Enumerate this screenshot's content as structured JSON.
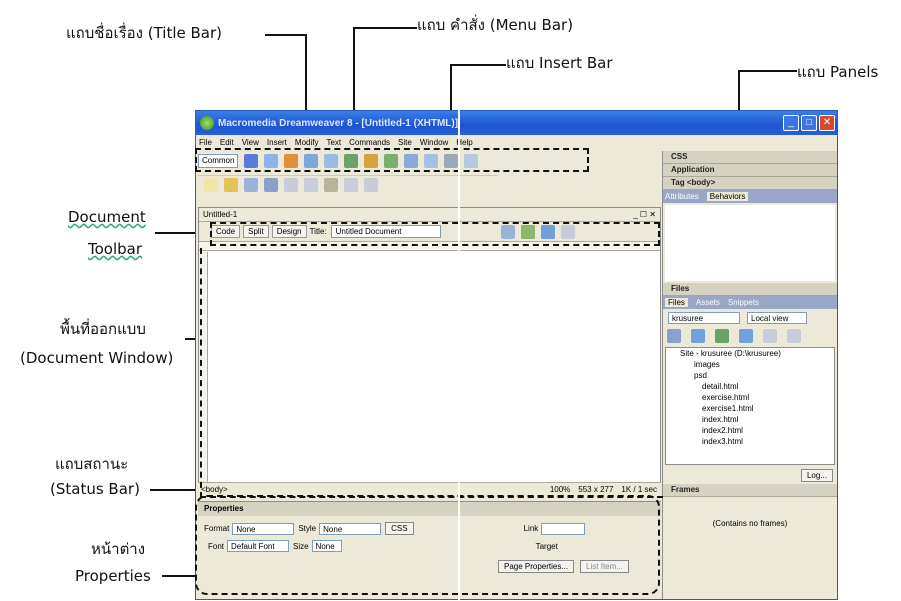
{
  "annotations": {
    "title_bar": "แถบชื่อเรื่อง (Title Bar)",
    "menu_bar": "แถบ คำสั่ง (Menu Bar)",
    "insert_bar": "แถบ Insert Bar",
    "panels": "แถบ Panels",
    "document_toolbar_1": "Document",
    "document_toolbar_2": "Toolbar",
    "design_area_1": "พื้นที่ออกแบบ",
    "design_area_2": "(Document Window)",
    "status_bar_1": "แถบสถานะ",
    "status_bar_2": "(Status Bar)",
    "properties_1": "หน้าต่าง",
    "properties_2": "Properties"
  },
  "window": {
    "title": "Macromedia Dreamweaver 8 - [Untitled-1 (XHTML)]",
    "minimize": "_",
    "maximize": "□",
    "close": "✕"
  },
  "menu": [
    "File",
    "Edit",
    "View",
    "Insert",
    "Modify",
    "Text",
    "Commands",
    "Site",
    "Window",
    "Help"
  ],
  "insert": {
    "category": "Common"
  },
  "document": {
    "tab": "Untitled-1",
    "code": "Code",
    "split": "Split",
    "design": "Design",
    "title_label": "Title:",
    "title_value": "Untitled Document",
    "win_controls": "_ ☐ ✕"
  },
  "status": {
    "tag": "<body>",
    "zoom": "100%",
    "size": "553 x 277",
    "download": "1K / 1 sec"
  },
  "properties": {
    "header": "Properties",
    "format_label": "Format",
    "format_value": "None",
    "style_label": "Style",
    "style_value": "None",
    "css_button": "CSS",
    "link_label": "Link",
    "font_label": "Font",
    "font_value": "Default Font",
    "size_label": "Size",
    "size_value": "None",
    "target_label": "Target",
    "page_properties": "Page Properties...",
    "list_item": "List Item..."
  },
  "panels": {
    "css": "CSS",
    "application": "Application",
    "tag": "Tag <body>",
    "attributes_tab": "Attributes",
    "behaviors_tab": "Behaviors",
    "files": "Files",
    "files_tab": "Files",
    "assets_tab": "Assets",
    "snippets_tab": "Snippets",
    "site_select": "krusuree",
    "view_select": "Local view",
    "tree": [
      "Site - krusuree (D:\\krusuree)",
      "images",
      "psd",
      "detail.html",
      "exercise.html",
      "exercise1.html",
      "index.html",
      "index2.html",
      "index3.html"
    ],
    "log_button": "Log...",
    "frames": "Frames",
    "frames_empty": "(Contains no frames)"
  },
  "colors": {
    "titlebar": "#1b55d0",
    "chrome": "#ece9d8",
    "accent_close": "#d84b2a"
  }
}
